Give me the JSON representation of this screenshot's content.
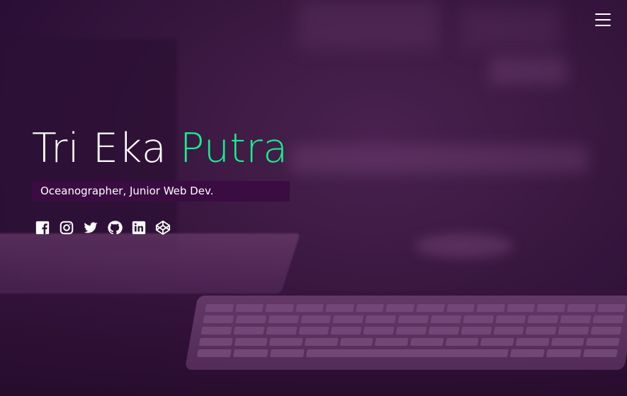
{
  "menu": {
    "icon": "hamburger-menu-icon"
  },
  "hero": {
    "name_first": "Tri Eka ",
    "name_accent": "Putra",
    "subtitle": "Oceanographer, Junior Web Dev.",
    "accent_color": "#13f08c",
    "subtitle_bg": "#3a0c42"
  },
  "socials": [
    {
      "icon": "facebook-icon"
    },
    {
      "icon": "instagram-icon"
    },
    {
      "icon": "twitter-icon"
    },
    {
      "icon": "github-icon"
    },
    {
      "icon": "linkedin-icon"
    },
    {
      "icon": "codepen-icon"
    }
  ]
}
